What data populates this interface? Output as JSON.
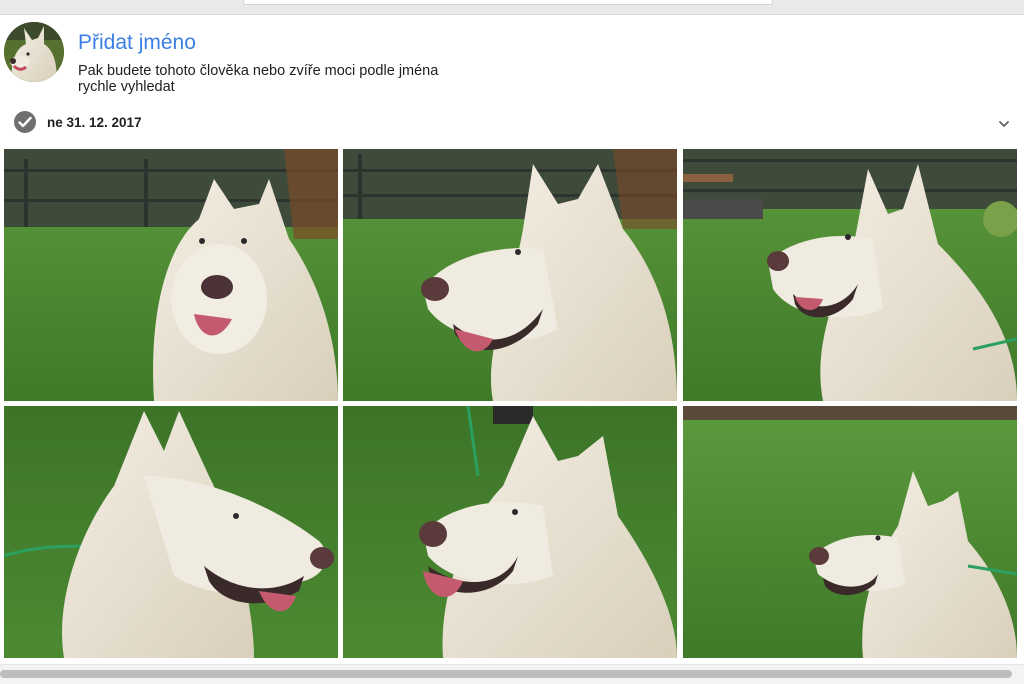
{
  "person": {
    "add_name_label": "Přidat jméno",
    "description_line1": "Pak budete tohoto člověka nebo zvíře moci podle jména",
    "description_line2": "rychle vyhledat"
  },
  "date_group": {
    "label": "ne 31. 12. 2017"
  },
  "icons": {
    "select_group": "check-circle-icon",
    "expand": "chevron-down-icon"
  },
  "colors": {
    "accent": "#3b7fe4",
    "grass": "#4d8a32",
    "dog_fur": "#ece6d8"
  },
  "photos": [
    {
      "subject": "white-dog-front"
    },
    {
      "subject": "white-dog-left"
    },
    {
      "subject": "white-dog-left"
    },
    {
      "subject": "white-dog-right"
    },
    {
      "subject": "white-dog-left"
    },
    {
      "subject": "white-dog-left-small"
    }
  ]
}
